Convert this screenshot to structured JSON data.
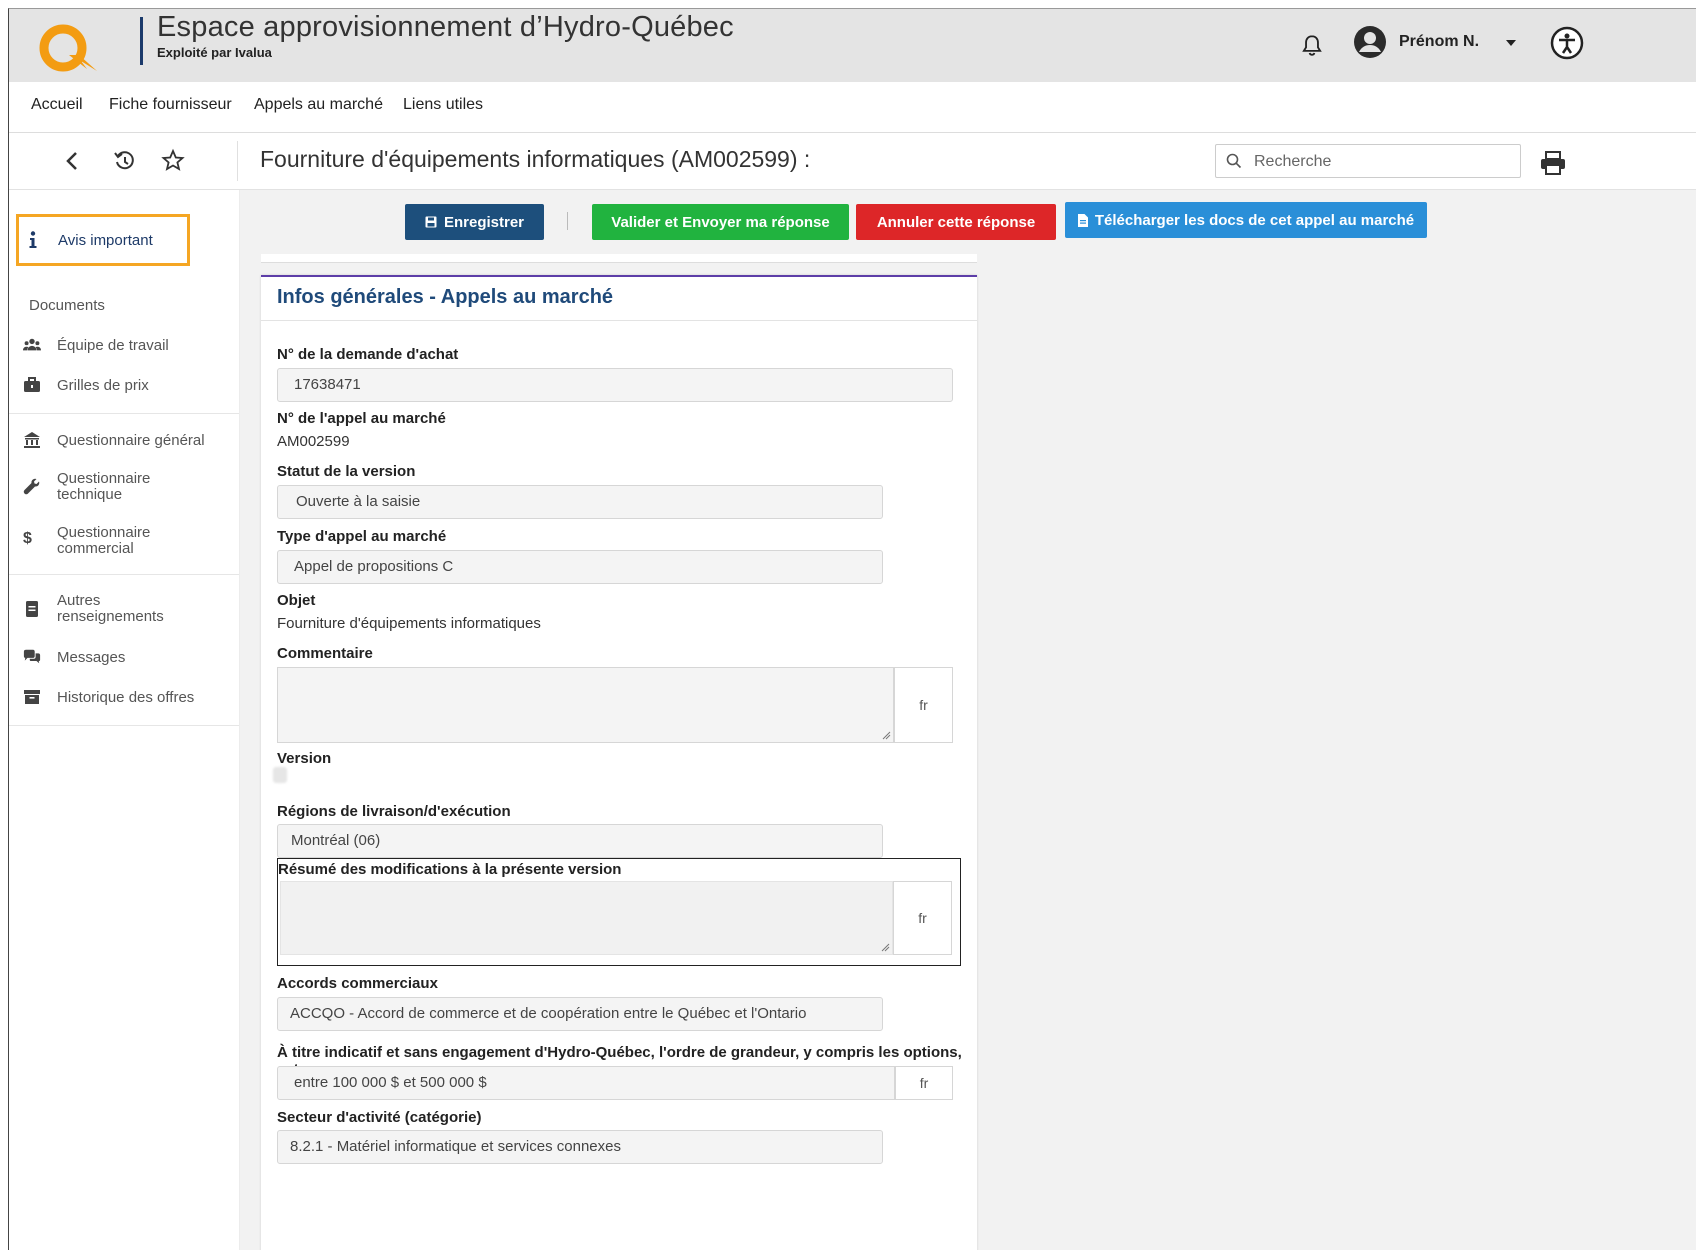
{
  "header": {
    "title": "Espace approvisionnement d’Hydro-Québec",
    "subtitle": "Exploité par Ivalua",
    "user_name": "Prénom N."
  },
  "nav": {
    "items": [
      "Accueil",
      "Fiche fournisseur",
      "Appels au marché",
      "Liens utiles"
    ]
  },
  "toolbar": {
    "page_title": "Fourniture d'équipements informatiques (AM002599) :",
    "search_placeholder": "Recherche"
  },
  "sidebar": {
    "highlighted": "Avis important",
    "items": [
      {
        "label": "Documents",
        "icon": "none"
      },
      {
        "label": "Équipe de travail",
        "icon": "users-icon"
      },
      {
        "label": "Grilles de prix",
        "icon": "briefcase-icon"
      },
      {
        "label": "Questionnaire général",
        "icon": "bank-icon"
      },
      {
        "label": "Questionnaire technique",
        "icon": "wrench-icon"
      },
      {
        "label": "Questionnaire commercial",
        "icon": "dollar-icon"
      },
      {
        "label": "Autres renseignements",
        "icon": "document-icon"
      },
      {
        "label": "Messages",
        "icon": "chat-icon"
      },
      {
        "label": "Historique des offres",
        "icon": "archive-icon"
      }
    ]
  },
  "actions": {
    "save": "Enregistrer",
    "submit": "Valider et Envoyer ma réponse",
    "cancel": "Annuler cette réponse",
    "download": "Télécharger les docs de cet appel au marché"
  },
  "colors": {
    "save": "#1d4f7c",
    "submit": "#21b33f",
    "cancel": "#dd2628",
    "download": "#2a8fd8",
    "highlight": "#f5a623",
    "card_title": "#1f4a7a"
  },
  "form": {
    "card_title": "Infos générales - Appels au marché",
    "demande_label": "N° de la demande d'achat",
    "demande_value": "17638471",
    "appel_label": "N° de l'appel au marché",
    "appel_value": "AM002599",
    "statut_label": "Statut de la version",
    "statut_value": "Ouverte à la saisie",
    "type_label": "Type d'appel au marché",
    "type_value": "Appel de propositions C",
    "objet_label": "Objet",
    "objet_value": "Fourniture d'équipements informatiques",
    "commentaire_label": "Commentaire",
    "lang": "fr",
    "version_label": "Version",
    "regions_label": "Régions de livraison/d'exécution",
    "regions_value": "Montréal (06)",
    "resume_label": "Résumé des modifications à la présente version",
    "accords_label": "Accords commerciaux",
    "accords_value": "ACCQO - Accord de commerce et de coopération entre le Québec et l'Ontario",
    "indicatif_label": "À titre indicatif et sans engagement d'Hydro-Québec, l'ordre de grandeur, y compris les options, est",
    "indicatif_value": "entre 100 000 $ et 500 000 $",
    "secteur_label": "Secteur d'activité (catégorie)",
    "secteur_value": "8.2.1 - Matériel informatique et services connexes"
  }
}
